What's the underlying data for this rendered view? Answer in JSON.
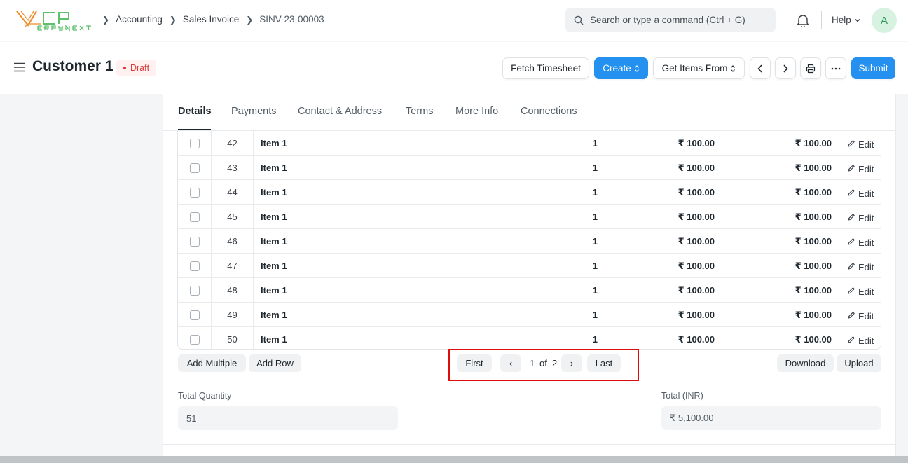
{
  "navbar": {
    "breadcrumbs": [
      "Accounting",
      "Sales Invoice",
      "SINV-23-00003"
    ],
    "search_placeholder": "Search or type a command (Ctrl + G)",
    "help_label": "Help",
    "avatar_initial": "A"
  },
  "page": {
    "title": "Customer 1",
    "status": "Draft",
    "status_color": "#e03636",
    "buttons": {
      "fetch_timesheet": "Fetch Timesheet",
      "create": "Create",
      "get_items_from": "Get Items From",
      "submit": "Submit"
    },
    "accent_color": "#2490ef"
  },
  "tabs": [
    "Details",
    "Payments",
    "Contact & Address",
    "Terms",
    "More Info",
    "Connections"
  ],
  "active_tab": "Details",
  "items_table": {
    "rows": [
      {
        "idx": "42",
        "item": "Item 1",
        "qty": "1",
        "rate": "₹ 100.00",
        "amount": "₹ 100.00"
      },
      {
        "idx": "43",
        "item": "Item 1",
        "qty": "1",
        "rate": "₹ 100.00",
        "amount": "₹ 100.00"
      },
      {
        "idx": "44",
        "item": "Item 1",
        "qty": "1",
        "rate": "₹ 100.00",
        "amount": "₹ 100.00"
      },
      {
        "idx": "45",
        "item": "Item 1",
        "qty": "1",
        "rate": "₹ 100.00",
        "amount": "₹ 100.00"
      },
      {
        "idx": "46",
        "item": "Item 1",
        "qty": "1",
        "rate": "₹ 100.00",
        "amount": "₹ 100.00"
      },
      {
        "idx": "47",
        "item": "Item 1",
        "qty": "1",
        "rate": "₹ 100.00",
        "amount": "₹ 100.00"
      },
      {
        "idx": "48",
        "item": "Item 1",
        "qty": "1",
        "rate": "₹ 100.00",
        "amount": "₹ 100.00"
      },
      {
        "idx": "49",
        "item": "Item 1",
        "qty": "1",
        "rate": "₹ 100.00",
        "amount": "₹ 100.00"
      },
      {
        "idx": "50",
        "item": "Item 1",
        "qty": "1",
        "rate": "₹ 100.00",
        "amount": "₹ 100.00"
      }
    ],
    "edit_label": "Edit",
    "add_multiple": "Add Multiple",
    "add_row": "Add Row",
    "download": "Download",
    "upload": "Upload",
    "pagination": {
      "first": "First",
      "last": "Last",
      "prev": "‹",
      "next": "›",
      "current_page": "1",
      "of_label": "of",
      "total_pages": "2"
    }
  },
  "totals": {
    "total_quantity_label": "Total Quantity",
    "total_quantity_value": "51",
    "total_label": "Total (INR)",
    "total_value": "₹ 5,100.00"
  }
}
